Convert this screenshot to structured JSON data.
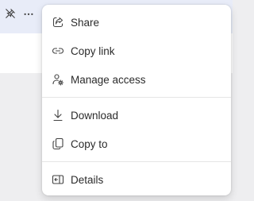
{
  "menu": {
    "items": [
      {
        "label": "Share",
        "icon": "share-icon"
      },
      {
        "label": "Copy link",
        "icon": "link-icon"
      },
      {
        "label": "Manage access",
        "icon": "manage-access-icon"
      },
      {
        "label": "Download",
        "icon": "download-icon"
      },
      {
        "label": "Copy to",
        "icon": "copy-icon"
      },
      {
        "label": "Details",
        "icon": "details-icon"
      }
    ]
  },
  "toolbar": {
    "icons": [
      "pin-off-icon",
      "more-options-icon"
    ]
  },
  "colors": {
    "row_highlight": "#e8ecf8",
    "menu_bg": "#ffffff",
    "text": "#2b2b2b",
    "icon": "#424242"
  }
}
